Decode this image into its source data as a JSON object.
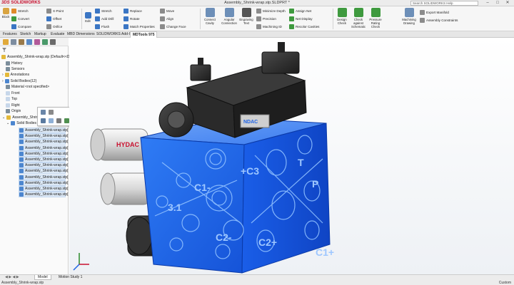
{
  "app": {
    "logo_brand": "3DS",
    "logo_text": "SOLIDWORKS",
    "document_title": "Assembly_Shrink-wrap.stp.SLDPRT *",
    "help_search_placeholder": "Search SOLIDWORKS Help",
    "window_controls": [
      "–",
      "□",
      "✕"
    ]
  },
  "ribbon": {
    "small_block": [
      "Block"
    ],
    "col1": [
      "Stretch",
      "Convert",
      "Compare"
    ],
    "col2": [
      "X-Point",
      "Offset",
      "Orifice"
    ],
    "edit_label": "Edit",
    "col3": [
      "Stretch",
      "Add Drill",
      "Flush"
    ],
    "col4": [
      "Replace",
      "Rotate",
      "Match Properties"
    ],
    "col5": [
      "Move",
      "Align",
      "Change Face"
    ],
    "connect_cavity": "Connect Cavity",
    "angular_connection": "Angular Connection",
    "engraving_text": "Engraving Text",
    "col6": [
      "Minimize Depth",
      "Precision",
      "Machining ID"
    ],
    "col7": [
      "Assign Net",
      "Net Display",
      "Recolor Cavities"
    ],
    "design_check": "Design Check",
    "check_against_schematic": "Check against Schematic",
    "pressure_rating_check": "Pressure Rating Check",
    "machining_drawing": "Machining Drawing",
    "col8": [
      "Export Manifold",
      "Assembly Constraints"
    ]
  },
  "tabs": {
    "items": [
      "Features",
      "Sketch",
      "Markup",
      "Evaluate",
      "MBD Dimensions",
      "SOLIDWORKS Add-Ins",
      "MDTools 975"
    ],
    "active": "MDTools 975"
  },
  "tree": {
    "root": "Assembly_Shrink-wrap.stp (Default<<D...",
    "items": [
      "History",
      "Sensors",
      "Annotations",
      "Solid Bodies(12)",
      "Material <not specified>",
      "Front",
      "Top",
      "Right",
      "Origin",
      "Assembly_Shrink",
      "Solid Bodies"
    ],
    "bodies": [
      "Assembly_Shrink-wrap.stp[",
      "Assembly_Shrink-wrap.stp[",
      "Assembly_Shrink-wrap.stp[",
      "Assembly_Shrink-wrap.stp[",
      "Assembly_Shrink-wrap.stp[",
      "Assembly_Shrink-wrap.stp[",
      "Assembly_Shrink-wrap.stp[",
      "Assembly_Shrink-wrap.stp[",
      "Assembly_Shrink-wrap.stp[",
      "Assembly_Shrink-wrap.stp[",
      "Assembly_Shrink-wrap.stp[",
      "Assembly_Shrink-wrap.stp["
    ]
  },
  "viewport": {
    "labels": [
      "C1-",
      "C2-",
      "3.1",
      "C2+",
      "C1+",
      "P",
      "+C3",
      "T",
      "NDAC",
      "HYDAC"
    ]
  },
  "bottom": {
    "tabs": [
      "Model",
      "Motion Study 1"
    ],
    "status_left": "Assembly_Shrink-wrap.stp",
    "status_right": "Custom"
  },
  "colors": {
    "manifold_blue": "#1e63e6",
    "tree_selection": "#b9d3f2",
    "logo_red": "#c8102e"
  }
}
